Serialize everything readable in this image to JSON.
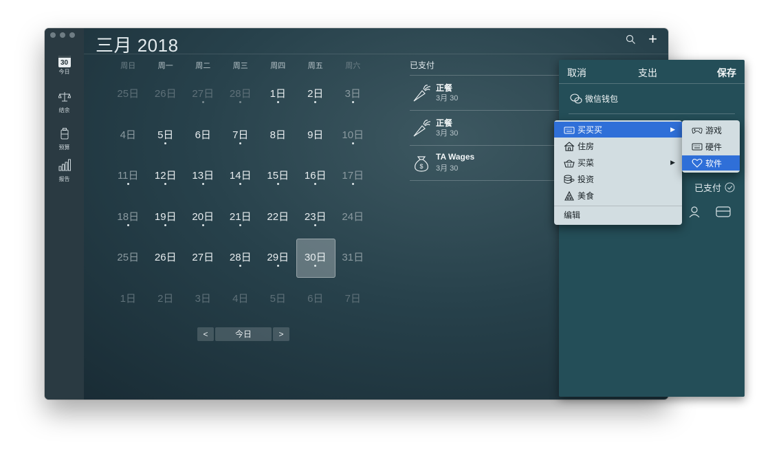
{
  "sidebar": {
    "calendar_day": "30",
    "items": [
      {
        "label": "今日",
        "icon": "calendar-icon"
      },
      {
        "label": "结余",
        "icon": "scales-icon"
      },
      {
        "label": "预算",
        "icon": "budget-icon"
      },
      {
        "label": "报告",
        "icon": "chart-icon"
      }
    ]
  },
  "header": {
    "title": "三月 2018"
  },
  "weekdays": [
    "周日",
    "周一",
    "周二",
    "周三",
    "周四",
    "周五",
    "周六"
  ],
  "calendar": {
    "rows": [
      [
        "25日",
        "26日",
        "27日",
        "28日",
        "1日",
        "2日",
        "3日"
      ],
      [
        "4日",
        "5日",
        "6日",
        "7日",
        "8日",
        "9日",
        "10日"
      ],
      [
        "11日",
        "12日",
        "13日",
        "14日",
        "15日",
        "16日",
        "17日"
      ],
      [
        "18日",
        "19日",
        "20日",
        "21日",
        "22日",
        "23日",
        "24日"
      ],
      [
        "25日",
        "26日",
        "27日",
        "28日",
        "29日",
        "30日",
        "31日"
      ],
      [
        "1日",
        "2日",
        "3日",
        "4日",
        "5日",
        "6日",
        "7日"
      ]
    ],
    "selected": "30日"
  },
  "pager": {
    "prev": "<",
    "today": "今日",
    "next": ">"
  },
  "transactions": {
    "header": "已支付",
    "items": [
      {
        "name": "正餐",
        "date": "3月 30",
        "icon": "carrot-icon"
      },
      {
        "name": "正餐",
        "date": "3月 30",
        "icon": "carrot-icon"
      },
      {
        "name": "TA Wages",
        "date": "3月 30",
        "icon": "money-bag-icon"
      }
    ]
  },
  "expense": {
    "cancel": "取消",
    "title": "支出",
    "save": "保存",
    "wallet": "微信钱包",
    "paid": "已支付"
  },
  "menu": {
    "items": [
      {
        "label": "买买买",
        "icon": "keyboard-icon",
        "submenu": true
      },
      {
        "label": "住房",
        "icon": "house-icon",
        "submenu": false
      },
      {
        "label": "买菜",
        "icon": "basket-icon",
        "submenu": true
      },
      {
        "label": "投资",
        "icon": "coins-icon",
        "submenu": false
      },
      {
        "label": "美食",
        "icon": "pizza-icon",
        "submenu": false
      }
    ],
    "edit": "编辑"
  },
  "submenu": {
    "items": [
      {
        "label": "游戏",
        "icon": "gamepad-icon"
      },
      {
        "label": "硬件",
        "icon": "keyboard-icon"
      },
      {
        "label": "软件",
        "icon": "heart-icon"
      }
    ]
  },
  "colors": {
    "accent": "#2f6fd8",
    "panel": "#244e58"
  }
}
